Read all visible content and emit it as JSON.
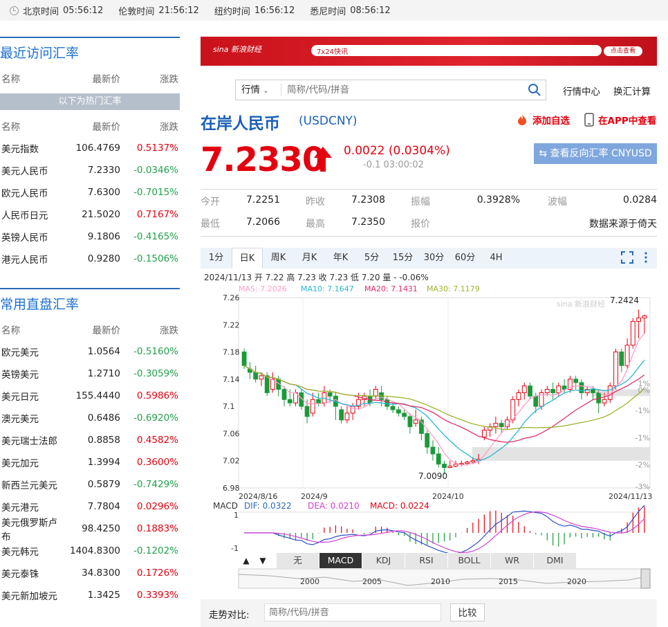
{
  "clocks": [
    {
      "label": "北京时间",
      "time": "05:56:12"
    },
    {
      "label": "伦敦时间",
      "time": "21:56:12"
    },
    {
      "label": "纽约时间",
      "time": "16:56:12"
    },
    {
      "label": "悉尼时间",
      "time": "08:56:12"
    }
  ],
  "recent": {
    "title": "最近访问汇率",
    "headers": [
      "名称",
      "最新价",
      "涨跌"
    ],
    "hot_label": "以下为热门汇率",
    "rows": [
      {
        "name": "美元指数",
        "price": "106.4769",
        "chg": "0.5137%",
        "dir": "up"
      },
      {
        "name": "美元人民币",
        "price": "7.2330",
        "chg": "-0.0346%",
        "dir": "down"
      },
      {
        "name": "欧元人民币",
        "price": "7.6300",
        "chg": "-0.7015%",
        "dir": "down"
      },
      {
        "name": "人民币日元",
        "price": "21.5020",
        "chg": "0.7167%",
        "dir": "up"
      },
      {
        "name": "英镑人民币",
        "price": "9.1806",
        "chg": "-0.4165%",
        "dir": "down"
      },
      {
        "name": "港元人民币",
        "price": "0.9280",
        "chg": "-0.1506%",
        "dir": "down"
      }
    ]
  },
  "direct": {
    "title": "常用直盘汇率",
    "headers": [
      "名称",
      "最新价",
      "涨跌"
    ],
    "rows": [
      {
        "name": "欧元美元",
        "price": "1.0564",
        "chg": "-0.5160%",
        "dir": "down"
      },
      {
        "name": "英镑美元",
        "price": "1.2710",
        "chg": "-0.3059%",
        "dir": "down"
      },
      {
        "name": "美元日元",
        "price": "155.4440",
        "chg": "0.5986%",
        "dir": "up"
      },
      {
        "name": "澳元美元",
        "price": "0.6486",
        "chg": "-0.6920%",
        "dir": "down"
      },
      {
        "name": "美元瑞士法郎",
        "price": "0.8858",
        "chg": "0.4582%",
        "dir": "up"
      },
      {
        "name": "美元加元",
        "price": "1.3994",
        "chg": "0.3600%",
        "dir": "up"
      },
      {
        "name": "新西兰元美元",
        "price": "0.5879",
        "chg": "-0.7429%",
        "dir": "down"
      },
      {
        "name": "美元港元",
        "price": "7.7804",
        "chg": "0.0296%",
        "dir": "up"
      },
      {
        "name": "美元俄罗斯卢布",
        "price": "98.4250",
        "chg": "0.1883%",
        "dir": "up"
      },
      {
        "name": "美元韩元",
        "price": "1404.8300",
        "chg": "-0.1202%",
        "dir": "down"
      },
      {
        "name": "美元泰铢",
        "price": "34.8300",
        "chg": "0.1726%",
        "dir": "up"
      },
      {
        "name": "美元新加坡元",
        "price": "1.3425",
        "chg": "0.3393%",
        "dir": "up"
      }
    ]
  },
  "banner": {
    "brand": "sina 新浪财经",
    "tag": "7x24快讯",
    "cta": "点击查看",
    "accent": "#d8161f"
  },
  "search": {
    "select": "行情",
    "placeholder": "简称/代码/拼音"
  },
  "nav": {
    "market_center": "行情中心",
    "calculator": "换汇计算"
  },
  "quote": {
    "title": "在岸人民币",
    "code": "(USDCNY)",
    "add_fav": "添加自选",
    "app_view": "在APP中查看",
    "price": "7.2330",
    "change": "0.0022 (0.0304%)",
    "sub": "-0.1 03:00:02",
    "reverse": "查看反向汇率 CNYUSD",
    "fields": [
      {
        "label": "今开",
        "value": "7.2251"
      },
      {
        "label": "昨收",
        "value": "7.2308"
      },
      {
        "label": "振幅",
        "value": "0.3928%"
      },
      {
        "label": "波幅",
        "value": "0.0284"
      },
      {
        "label": "最低",
        "value": "7.2066"
      },
      {
        "label": "最高",
        "value": "7.2350"
      },
      {
        "label": "报价",
        "value": ""
      },
      {
        "label": "",
        "value": "数据来源于倚天"
      }
    ]
  },
  "tabs": [
    "1分",
    "日K",
    "周K",
    "月K",
    "年K",
    "5分",
    "15分",
    "30分",
    "60分",
    "4H"
  ],
  "active_tab": "日K",
  "chart_info": {
    "ohlc": "2024/11/13 开 7.22 高 7.23 收 7.23 低 7.20 量 - -0.06%",
    "ma5": "MA5: 7.2026",
    "ma10": "MA10: 7.1647",
    "ma20": "MA20: 7.1431",
    "ma30": "MA30: 7.1179",
    "macd_label": "MACD",
    "dif": "DIF: 0.0322",
    "dea": "DEA: 0.0210",
    "macd": "MACD: 0.0224",
    "max_label": "7.2424",
    "min_label": "7.0090"
  },
  "ind_tabs": [
    "无",
    "MACD",
    "KDJ",
    "RSI",
    "BOLL",
    "WR",
    "DMI"
  ],
  "active_ind": "MACD",
  "nav_years": [
    "2000",
    "2005",
    "2010",
    "2015",
    "2020"
  ],
  "compare": {
    "label": "走势对比:",
    "placeholder": "简称/代码/拼音",
    "button": "比较"
  },
  "chart_data": {
    "type": "candlestick",
    "y_ticks": [
      "7.26",
      "7.22",
      "7.18",
      "7.14",
      "7.1",
      "7.06",
      "7.02",
      "6.98"
    ],
    "right_ticks": [
      "1%",
      "0%",
      "-1%",
      "-1%",
      "-2%",
      "-3%"
    ],
    "x_ticks": [
      "2024/8/16",
      "2024/9",
      "2024/10",
      "2024/11/13"
    ],
    "macd_ticks": [
      "1",
      "-1"
    ],
    "ylim": [
      6.98,
      7.26
    ],
    "colors": {
      "up": "#e3000f",
      "down": "#1a9a3a",
      "ma5": "#ff9ec8",
      "ma10": "#29b6d6",
      "ma20": "#e0306a",
      "ma30": "#9bb52c"
    },
    "candles": [
      [
        7.18,
        7.16,
        7.185,
        7.155
      ],
      [
        7.155,
        7.15,
        7.165,
        7.14
      ],
      [
        7.15,
        7.14,
        7.16,
        7.135
      ],
      [
        7.14,
        7.145,
        7.15,
        7.13
      ],
      [
        7.145,
        7.12,
        7.15,
        7.115
      ],
      [
        7.125,
        7.14,
        7.15,
        7.12
      ],
      [
        7.14,
        7.125,
        7.145,
        7.115
      ],
      [
        7.125,
        7.11,
        7.13,
        7.1
      ],
      [
        7.11,
        7.105,
        7.125,
        7.1
      ],
      [
        7.105,
        7.12,
        7.125,
        7.1
      ],
      [
        7.12,
        7.1,
        7.125,
        7.095
      ],
      [
        7.1,
        7.085,
        7.11,
        7.075
      ],
      [
        7.09,
        7.11,
        7.12,
        7.085
      ],
      [
        7.11,
        7.105,
        7.12,
        7.1
      ],
      [
        7.105,
        7.12,
        7.13,
        7.1
      ],
      [
        7.12,
        7.115,
        7.125,
        7.105
      ],
      [
        7.115,
        7.1,
        7.12,
        7.08
      ],
      [
        7.095,
        7.08,
        7.1,
        7.075
      ],
      [
        7.08,
        7.09,
        7.1,
        7.075
      ],
      [
        7.09,
        7.1,
        7.105,
        7.08
      ],
      [
        7.1,
        7.11,
        7.12,
        7.095
      ],
      [
        7.11,
        7.115,
        7.12,
        7.1
      ],
      [
        7.115,
        7.105,
        7.125,
        7.1
      ],
      [
        7.115,
        7.125,
        7.13,
        7.11
      ],
      [
        7.12,
        7.11,
        7.13,
        7.1
      ],
      [
        7.11,
        7.1,
        7.115,
        7.095
      ],
      [
        7.1,
        7.095,
        7.105,
        7.09
      ],
      [
        7.095,
        7.09,
        7.1,
        7.085
      ],
      [
        7.09,
        7.085,
        7.095,
        7.08
      ],
      [
        7.085,
        7.07,
        7.09,
        7.06
      ],
      [
        7.075,
        7.08,
        7.095,
        7.07
      ],
      [
        7.08,
        7.06,
        7.085,
        7.05
      ],
      [
        7.06,
        7.04,
        7.065,
        7.03
      ],
      [
        7.04,
        7.03,
        7.05,
        7.02
      ],
      [
        7.03,
        7.015,
        7.04,
        7.01
      ],
      [
        7.015,
        7.01,
        7.02,
        7.0
      ],
      [
        7.01,
        7.012,
        7.02,
        7.009
      ],
      [
        7.012,
        7.015,
        7.02,
        7.01
      ],
      [
        7.015,
        7.016,
        7.02,
        7.012
      ],
      [
        7.016,
        7.018,
        7.02,
        7.013
      ],
      [
        7.018,
        7.02,
        7.025,
        7.015
      ],
      [
        7.02,
        7.022,
        7.03,
        7.015
      ],
      [
        7.055,
        7.065,
        7.07,
        7.05
      ],
      [
        7.065,
        7.07,
        7.075,
        7.055
      ],
      [
        7.07,
        7.075,
        7.085,
        7.06
      ],
      [
        7.075,
        7.07,
        7.08,
        7.06
      ],
      [
        7.07,
        7.08,
        7.085,
        7.065
      ],
      [
        7.08,
        7.11,
        7.115,
        7.075
      ],
      [
        7.11,
        7.12,
        7.125,
        7.1
      ],
      [
        7.12,
        7.13,
        7.135,
        7.11
      ],
      [
        7.13,
        7.115,
        7.135,
        7.11
      ],
      [
        7.115,
        7.1,
        7.12,
        7.09
      ],
      [
        7.1,
        7.12,
        7.125,
        7.095
      ],
      [
        7.12,
        7.125,
        7.13,
        7.115
      ],
      [
        7.125,
        7.12,
        7.135,
        7.11
      ],
      [
        7.12,
        7.13,
        7.135,
        7.115
      ],
      [
        7.13,
        7.125,
        7.14,
        7.12
      ],
      [
        7.125,
        7.14,
        7.145,
        7.12
      ],
      [
        7.14,
        7.135,
        7.145,
        7.125
      ],
      [
        7.135,
        7.12,
        7.14,
        7.11
      ],
      [
        7.12,
        7.125,
        7.13,
        7.115
      ],
      [
        7.125,
        7.12,
        7.13,
        7.11
      ],
      [
        7.12,
        7.105,
        7.125,
        7.09
      ],
      [
        7.105,
        7.11,
        7.12,
        7.1
      ],
      [
        7.11,
        7.13,
        7.135,
        7.105
      ],
      [
        7.13,
        7.18,
        7.185,
        7.125
      ],
      [
        7.18,
        7.16,
        7.185,
        7.15
      ],
      [
        7.16,
        7.19,
        7.2,
        7.155
      ],
      [
        7.19,
        7.225,
        7.23,
        7.185
      ],
      [
        7.225,
        7.23,
        7.2424,
        7.2
      ],
      [
        7.23,
        7.233,
        7.235,
        7.207
      ]
    ]
  }
}
